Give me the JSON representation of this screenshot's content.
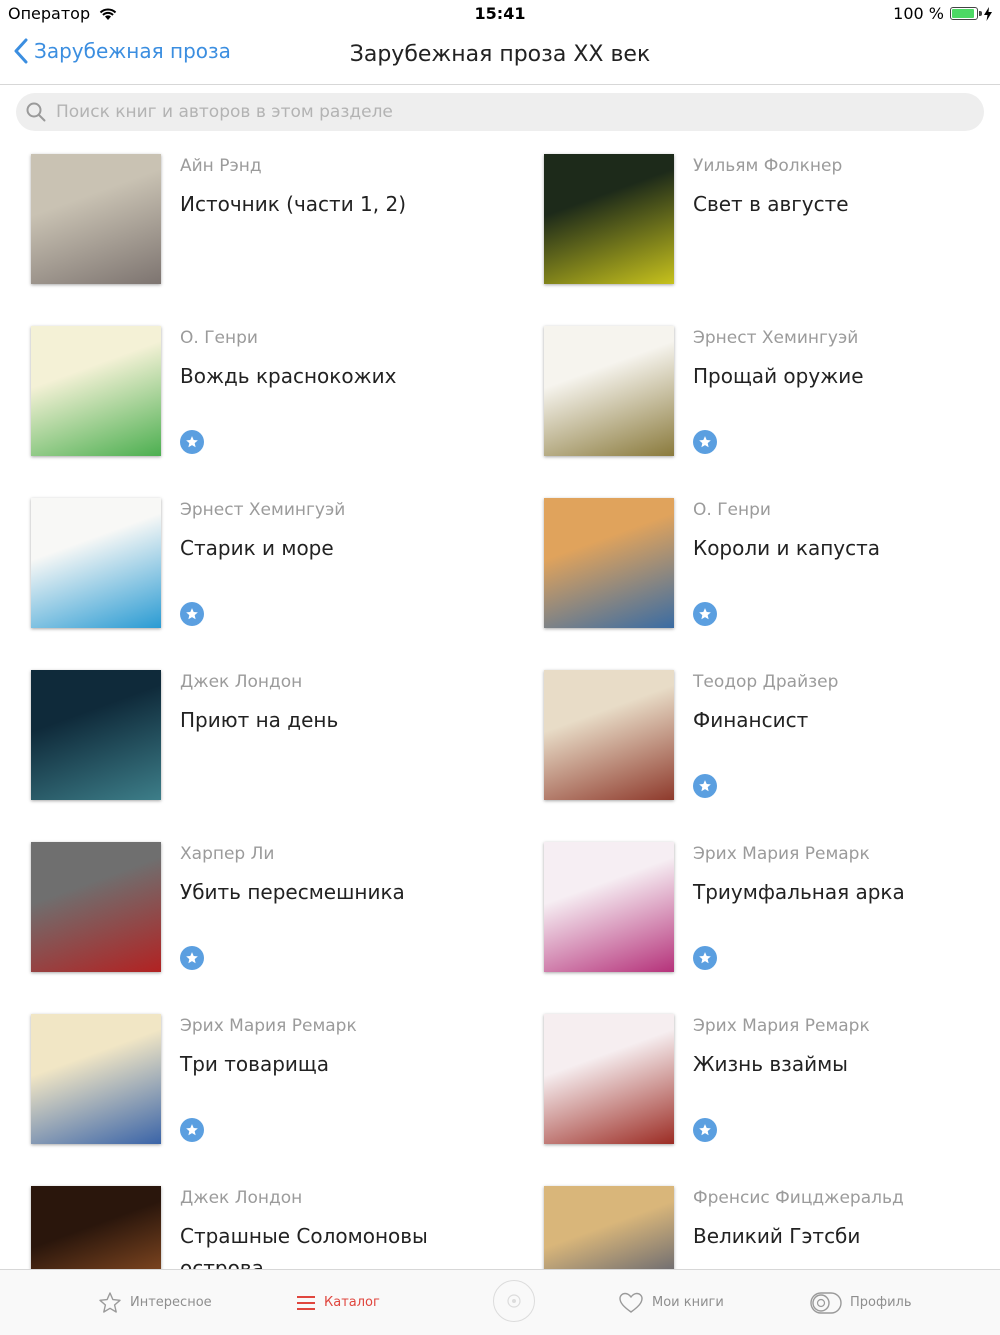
{
  "status_bar": {
    "carrier": "Оператор",
    "time": "15:41",
    "battery": "100 %"
  },
  "nav": {
    "back_label": "Зарубежная проза",
    "title": "Зарубежная проза XX век"
  },
  "search": {
    "placeholder": "Поиск книг и авторов в этом разделе"
  },
  "colors": {
    "accent_blue": "#3b8ee0",
    "badge_blue": "#5b9fe0",
    "active_tab_red": "#e0463e",
    "muted_gray": "#9b9b9b"
  },
  "books": [
    {
      "author": "Айн Рэнд",
      "title": "Источник (части 1, 2)",
      "badge": false,
      "cover_colors": [
        "#c9c2b3",
        "#7d7470"
      ]
    },
    {
      "author": "Уильям Фолкнер",
      "title": "Свет в августе",
      "badge": false,
      "cover_colors": [
        "#1d2a1a",
        "#c7c21c"
      ]
    },
    {
      "author": "О. Генри",
      "title": "Вождь краснокожих",
      "badge": true,
      "cover_colors": [
        "#f4f1d6",
        "#4caf50"
      ]
    },
    {
      "author": "Эрнест Хемингуэй",
      "title": "Прощай оружие",
      "badge": true,
      "cover_colors": [
        "#f6f4ee",
        "#8a7a3c"
      ]
    },
    {
      "author": "Эрнест Хемингуэй",
      "title": "Старик и море",
      "badge": true,
      "cover_colors": [
        "#f8f8f6",
        "#2a9bd3"
      ]
    },
    {
      "author": "О. Генри",
      "title": "Короли и капуста",
      "badge": true,
      "cover_colors": [
        "#e0a35c",
        "#3a6ca3"
      ]
    },
    {
      "author": "Джек Лондон",
      "title": "Приют на день",
      "badge": false,
      "cover_colors": [
        "#0f2a3a",
        "#3d7e89"
      ]
    },
    {
      "author": "Теодор Драйзер",
      "title": "Финансист",
      "badge": true,
      "cover_colors": [
        "#e8dcc7",
        "#8e3a2c"
      ]
    },
    {
      "author": "Харпер Ли",
      "title": "Убить пересмешника",
      "badge": true,
      "cover_colors": [
        "#6f6f6f",
        "#b22222"
      ]
    },
    {
      "author": "Эрих Мария Ремарк",
      "title": "Триумфальная арка",
      "badge": true,
      "cover_colors": [
        "#f6eef3",
        "#b5327a"
      ]
    },
    {
      "author": "Эрих Мария Ремарк",
      "title": "Три товарища",
      "badge": true,
      "cover_colors": [
        "#f1e6c5",
        "#3a64a8"
      ]
    },
    {
      "author": "Эрих Мария Ремарк",
      "title": "Жизнь взаймы",
      "badge": true,
      "cover_colors": [
        "#f6eef0",
        "#9c2c24"
      ]
    },
    {
      "author": "Джек Лондон",
      "title": "Страшные Соломоновы острова",
      "badge": false,
      "cover_colors": [
        "#2a160c",
        "#b0622c"
      ]
    },
    {
      "author": "Френсис Фицджеральд",
      "title": "Великий Гэтсби",
      "badge": true,
      "cover_colors": [
        "#d9b67a",
        "#2c3f6b"
      ]
    }
  ],
  "tabs": [
    {
      "label": "Интересное",
      "icon": "star-outline-icon",
      "active": false
    },
    {
      "label": "Каталог",
      "icon": "list-icon",
      "active": true
    },
    {
      "label": "",
      "icon": "player-circle-icon",
      "active": false
    },
    {
      "label": "Мои книги",
      "icon": "heart-icon",
      "active": false
    },
    {
      "label": "Профиль",
      "icon": "profile-toggle-icon",
      "active": false
    }
  ]
}
